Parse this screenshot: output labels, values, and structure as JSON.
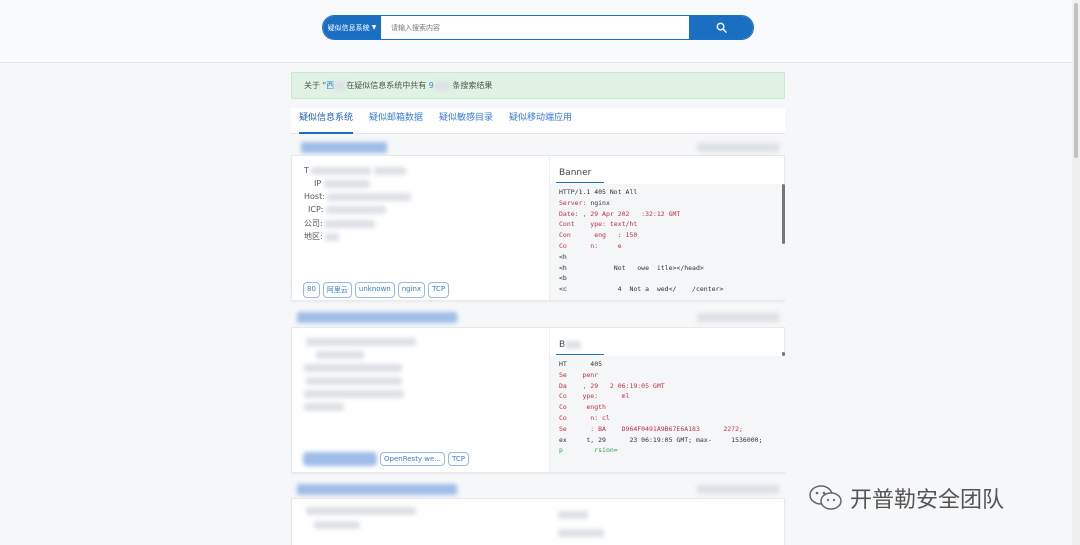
{
  "search": {
    "category": "疑似信息系统",
    "placeholder": "请输入搜索内容"
  },
  "notice": {
    "prefix": "关于 \"",
    "middle": "在疑似信息系统中共有",
    "count_prefix": "9",
    "suffix": "条搜索结果"
  },
  "tabs": [
    "疑似信息系统",
    "疑似邮箱数据",
    "疑似敏感目录",
    "疑似移动端应用"
  ],
  "result1": {
    "info_labels": [
      "T",
      "IP",
      "Host:",
      "ICP:",
      "公司:",
      "地区:"
    ],
    "tags": [
      "80",
      "阿里云",
      "unknown",
      "nginx",
      "TCP"
    ],
    "banner_title": "Banner",
    "banner_lines": [
      "HTTP/1.1 405 Not All",
      "Server: nginx",
      "Date: , 29 Apr 202   :32:12 GMT",
      "Cont    ype: text/ht",
      "Con      eng   : 150",
      "Co      n:     e",
      "",
      "<h",
      "<h            Not   owe  itle></head>",
      "<b",
      "<c             4  Not a  wed</    /center>"
    ]
  },
  "result2": {
    "tags": [
      "OpenResty we...",
      "TCP"
    ],
    "banner_title": "B",
    "banner_lines": [
      "HT      405",
      "Se    penr",
      "Da    , 29   2 06:19:05 GMT",
      "Co    ype:      ml",
      "Co     ength",
      "Co      n: cl",
      "Se      : BA    D964F0491A9B67E6A183      2272;",
      "ex     t, 29      23 06:19:05 GMT; max-     1536000;",
      "p        rsion="
    ]
  },
  "watermark": "开普勒安全团队"
}
